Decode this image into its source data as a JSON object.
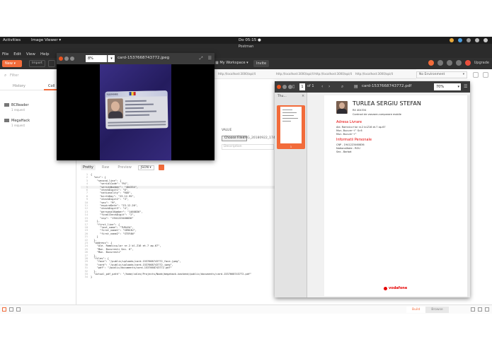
{
  "gnome": {
    "activities": "Activities",
    "app": "Image Viewer ▾",
    "clock": "Do 05:15 ●"
  },
  "postman": {
    "title": "Postman",
    "menu": [
      "File",
      "Edit",
      "View",
      "Help"
    ],
    "new_label": "New",
    "import_label": "Import",
    "workspace": "My Workspace",
    "invite": "Invite",
    "upgrade": "Upgrade"
  },
  "sidebar": {
    "filter_placeholder": "Filter",
    "tabs": [
      "History",
      "Coll"
    ],
    "collections": [
      {
        "name": "BCReader",
        "sub": "1 request"
      },
      {
        "name": "MegaHack",
        "sub": "1 request"
      }
    ]
  },
  "tabs": [
    "http://localhost:3000/api/4",
    "http://localhost:3000/api/4",
    "http://localhost:3000/api/4",
    "http://localhost:3000/api/4"
  ],
  "environment": "No Environment",
  "form": {
    "value_label": "VALUE",
    "choose_files": "Choose Files",
    "filename": "IMG_20180922_17434",
    "description": "Description"
  },
  "response": {
    "tabs": [
      "Pretty",
      "Raw",
      "Preview"
    ],
    "format": "JSON ▾",
    "lines": [
      "{",
      "  \"mrz\": {",
      "    \"second_line\": {",
      "      \"serialCode\": \"RX\",",
      "      \"seriesNumber\": \"404334\",",
      "      \"checkDigit1\": \"6\",",
      "      \"nationality\": \"ROU\",",
      "      \"birthDay\": \"23.12.95\",",
      "      \"checkDigit2\": \"3\",",
      "      \"sex\": \"M\",",
      "      \"expireDate\": \"23.12.20\",",
      "      \"checkDigit3\": \"4\",",
      "      \"personalNumber\": \"1460836\",",
      "      \"finalCheckDigit\": \"2\",",
      "      \"cnp\": \"1941223460836\"",
      "    },",
      "    \"first_line\": {",
      "      \"last_name\": \"TURLEA\",",
      "      \"first_name1\": \"SERGIU\",",
      "      \"first_name2\": \"STEFAN\"",
      "    }",
      "  },",
      "  \"address\": {",
      "    \"Ale. Ramnicu+lor nr.2 bl.Z16 et.7 ap.67\",",
      "    \"Mun. Bucuresti Sec. 6\",",
      "    \"Mun. Bucuresti\"",
      "  },",
      "  \"files\": {",
      "    \"face\": \"/public/uploads/card-1537668743772_face.jpeg\",",
      "    \"card\": \"/public/uploads/card-1537668743772.jpeg\",",
      "    \"pdf\": \"/public/documents/card-1537668743772.pdf\"",
      "  },",
      "  \"actual_pdf_path\": \"/home/calex/Projects/Node/megahack-backend/public/documents/card-1537668743772.pdf\"",
      "}"
    ]
  },
  "status": {
    "build": "Build",
    "browse": "Browse"
  },
  "image_viewer": {
    "zoom": "8%",
    "title": "card-1537668743772.jpeg",
    "card_header": "ROUMANIE"
  },
  "pdf_viewer": {
    "sidebar_title": "Thu...",
    "page_num": "1",
    "page_of": "of 1",
    "title": "card-1537668743772.pdf",
    "zoom": "70%",
    "thumb_page": "1",
    "name": "TURLEA SERGIU STEFAN",
    "doc_id": "RX 404334",
    "doc_sub": "Contract de vanzare-cumparare mobile",
    "sec_address": "Adresa Livrare",
    "address_lines": [
      "Ale. Ramnicu+lor nr.2 bl.Z16 et.7 ap.67",
      "Mun. Bucure~l^ Sr.6",
      "Mun. Bucure~l^"
    ],
    "sec_personal": "Informatii Personale",
    "personal_lines": [
      "CNP - 1941223460836",
      "Nationalitate - ROU",
      "Sex - Barbat"
    ],
    "brand": "vodafone"
  },
  "colors": {
    "accent": "#f26b3a",
    "vodafone_red": "#e60000"
  }
}
